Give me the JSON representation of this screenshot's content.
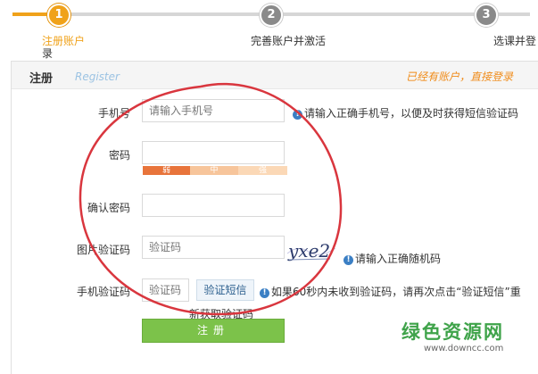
{
  "steps": [
    {
      "number": "1",
      "label": "注册账户",
      "label_line2": "录",
      "state": "active"
    },
    {
      "number": "2",
      "label": "完善账户并激活",
      "state": "inactive"
    },
    {
      "number": "3",
      "label": "选课并登",
      "state": "inactive"
    }
  ],
  "form_header": {
    "title": "注册",
    "subtitle": "Register",
    "login_link": "已经有账户，直接登录"
  },
  "fields": {
    "phone": {
      "label": "手机号",
      "placeholder": "请输入手机号",
      "hint": "请输入正确手机号，以便及时获得短信验证码"
    },
    "password": {
      "label": "密码",
      "placeholder": ""
    },
    "password_strength": {
      "weak": "弱",
      "medium": "中",
      "strong": "强"
    },
    "confirm_password": {
      "label": "确认密码",
      "placeholder": ""
    },
    "captcha": {
      "label": "图片验证码",
      "placeholder": "验证码",
      "image_text": "yxe2",
      "hint": "请输入正确随机码"
    },
    "sms": {
      "label": "手机验证码",
      "placeholder": "验证码",
      "button": "验证短信",
      "hint": "如果60秒内未收到验证码，请再次点击“验证短信”重",
      "hint_line2": "新获取验证码"
    }
  },
  "submit_label": "注册",
  "watermark": {
    "title": "绿色资源网",
    "url": "www.downcc.com"
  },
  "colors": {
    "accent": "#f0a21a",
    "submit": "#7cc24a",
    "annotation": "#d9363e",
    "info": "#3b7fc4"
  },
  "icons": [
    "info-icon",
    "captcha-image"
  ]
}
